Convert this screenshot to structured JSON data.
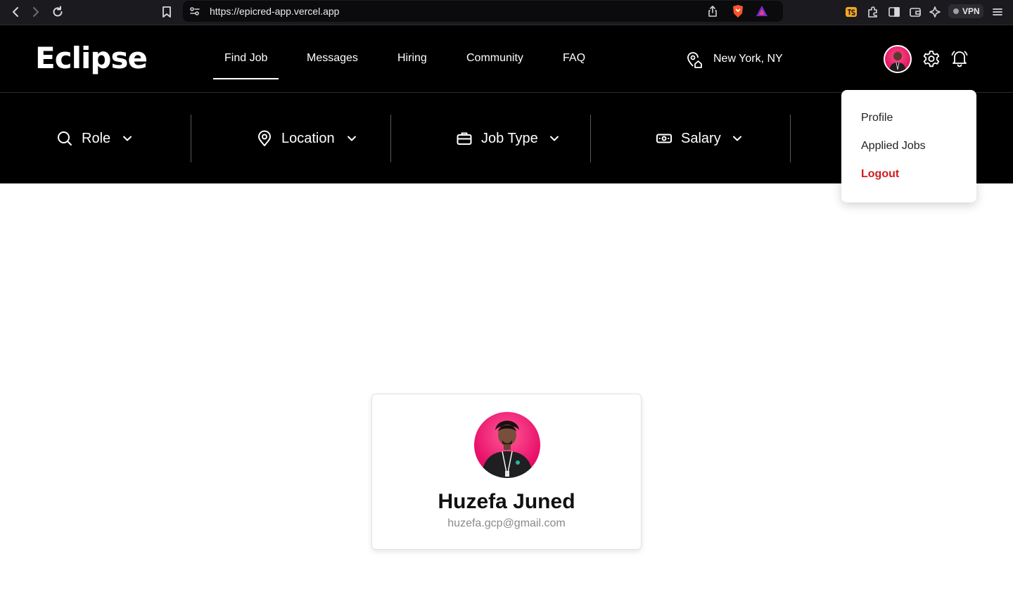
{
  "browser": {
    "url": "https://epicred-app.vercel.app",
    "vpn_label": "VPN"
  },
  "header": {
    "logo": "Eclipse",
    "nav": [
      {
        "label": "Find Job",
        "active": true
      },
      {
        "label": "Messages",
        "active": false
      },
      {
        "label": "Hiring",
        "active": false
      },
      {
        "label": "Community",
        "active": false
      },
      {
        "label": "FAQ",
        "active": false
      }
    ],
    "location": "New York, NY"
  },
  "filters": [
    {
      "label": "Role",
      "icon": "search-icon"
    },
    {
      "label": "Location",
      "icon": "location-pin-icon"
    },
    {
      "label": "Job Type",
      "icon": "briefcase-icon"
    },
    {
      "label": "Salary",
      "icon": "money-icon"
    }
  ],
  "user_menu": {
    "items": [
      "Profile",
      "Applied Jobs"
    ],
    "logout": "Logout",
    "logout_color": "#d01c1c"
  },
  "profile": {
    "name": "Huzefa Juned",
    "email": "huzefa.gcp@gmail.com"
  },
  "colors": {
    "header_bg": "#000000",
    "accent_pink": "#e8106a"
  }
}
